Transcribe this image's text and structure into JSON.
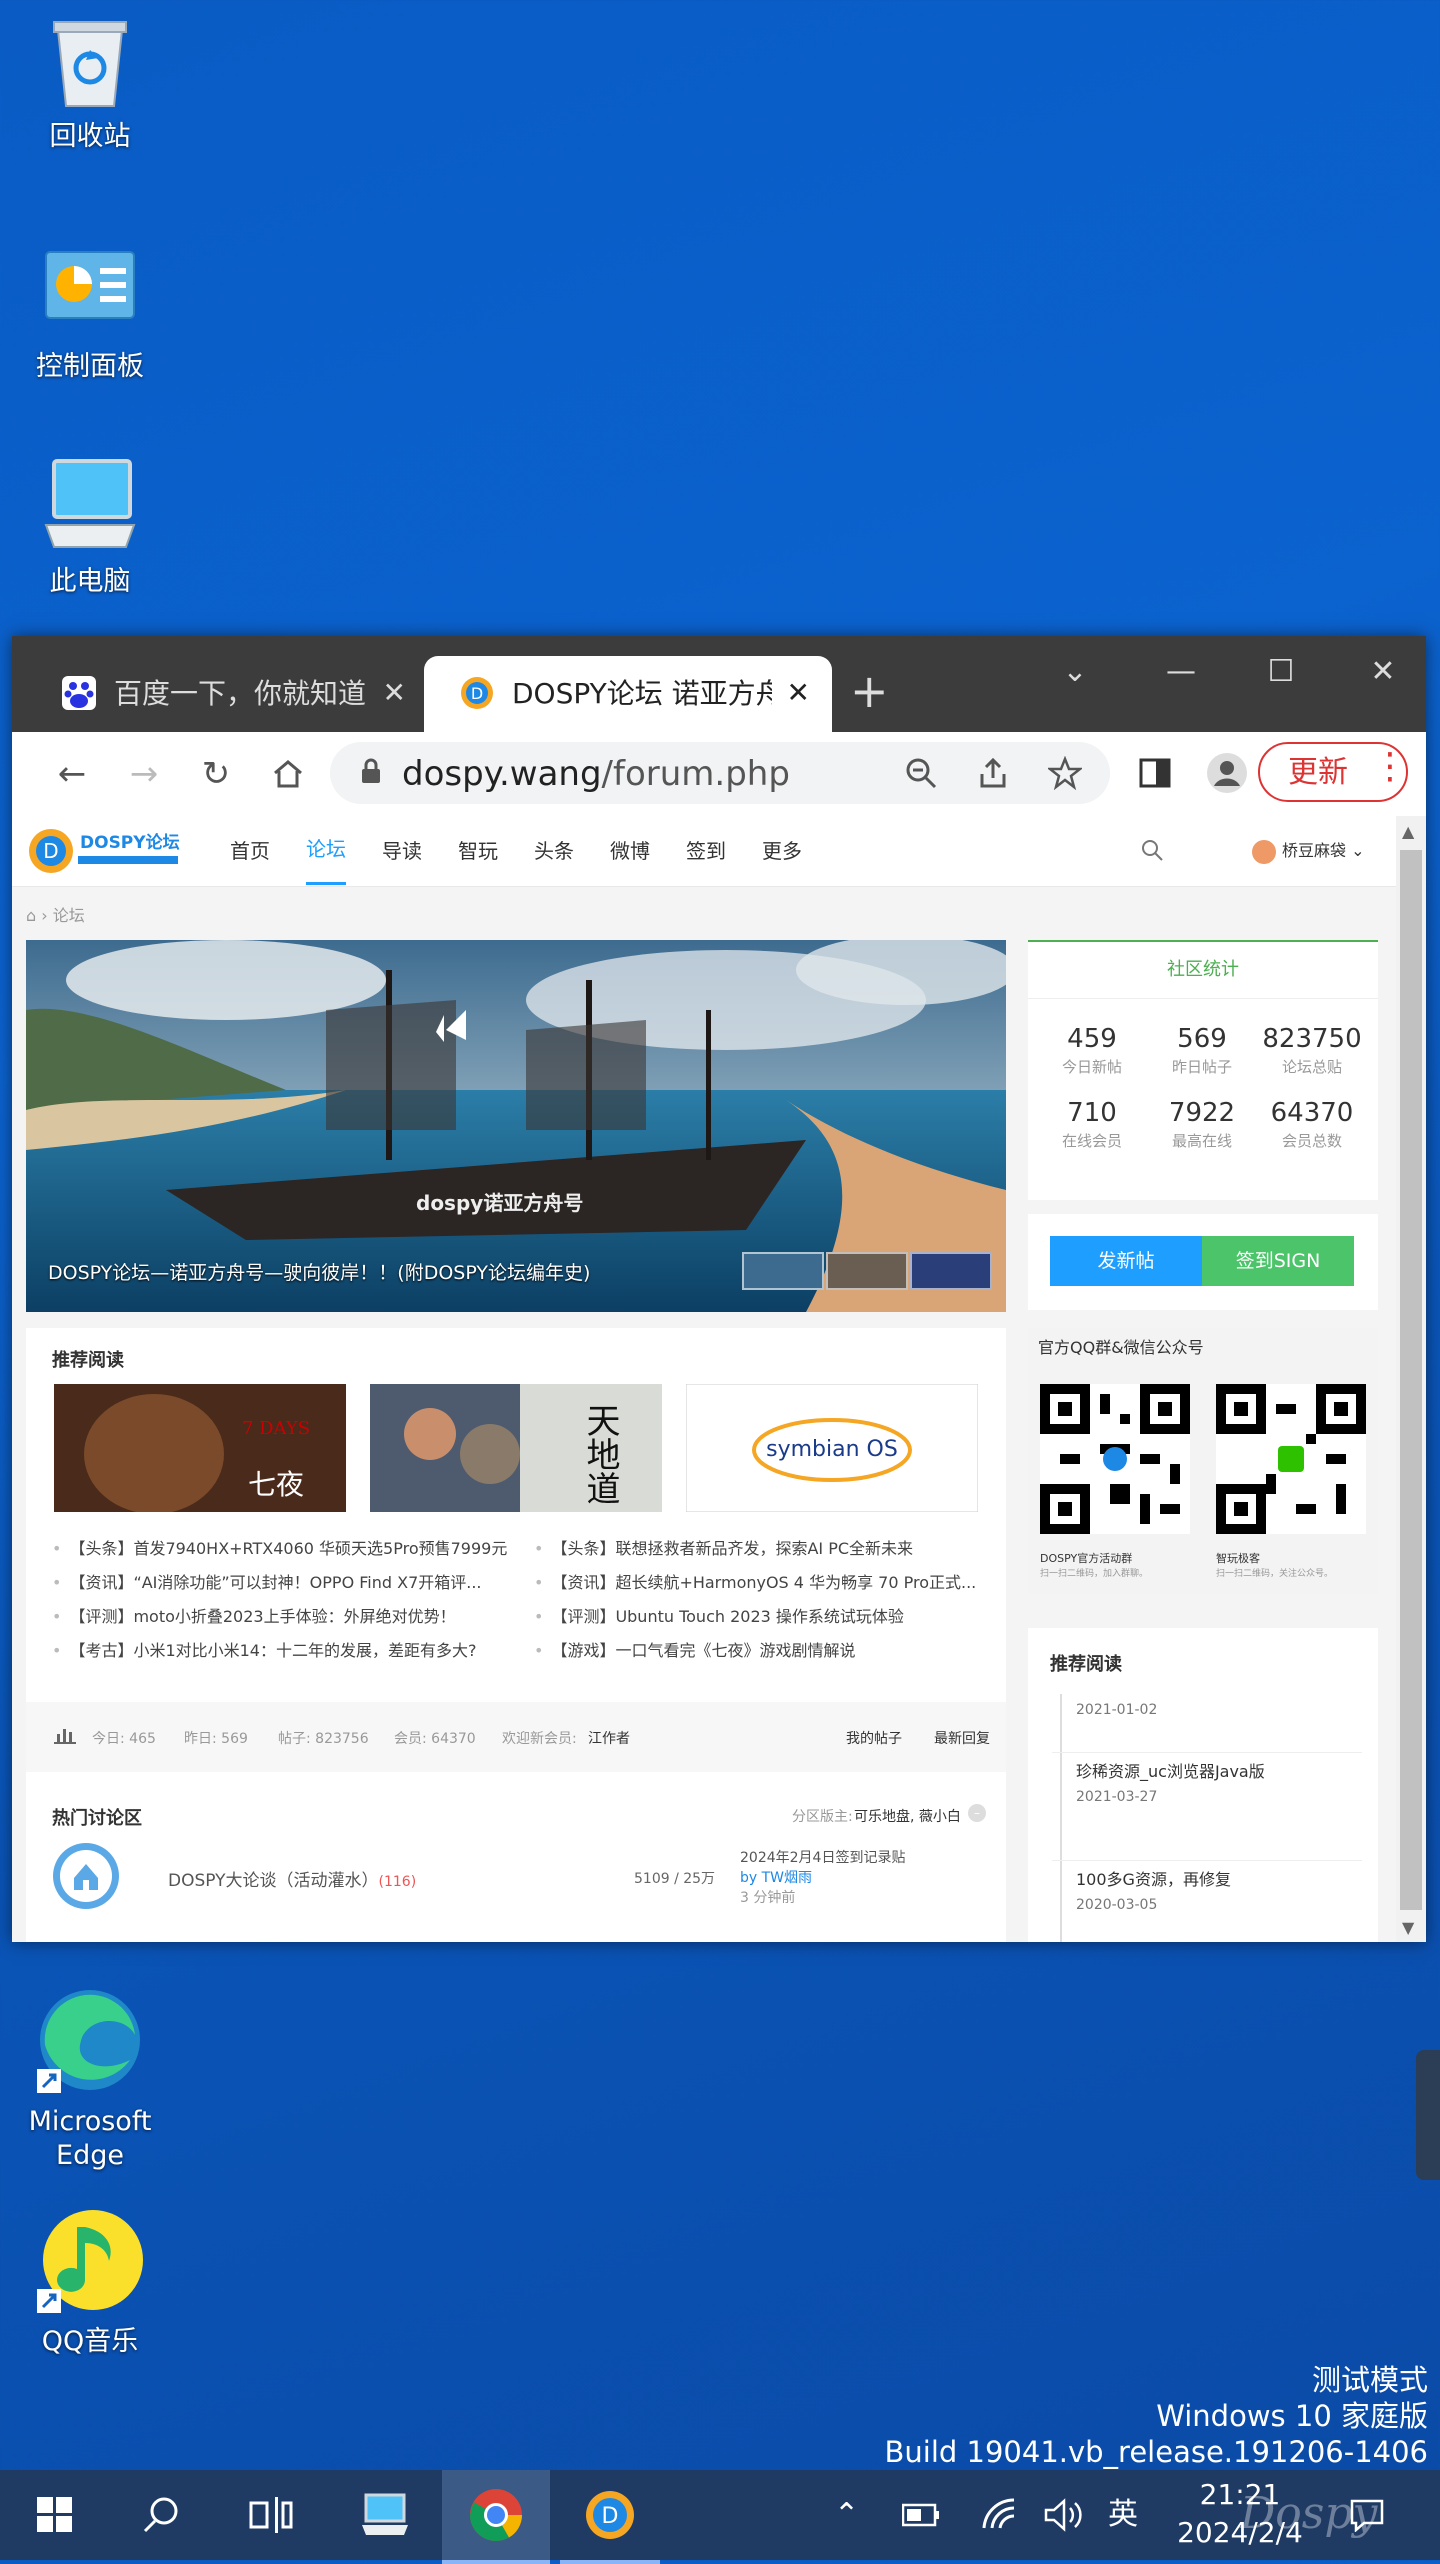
{
  "desktop": {
    "icons": [
      {
        "label": "回收站"
      },
      {
        "label": "控制面板"
      },
      {
        "label": "此电脑"
      },
      {
        "label": "Microsoft Edge"
      },
      {
        "label": "QQ音乐"
      }
    ],
    "watermark": [
      "测试模式",
      "Windows 10 家庭版",
      "Build 19041.vb_release.191206-1406"
    ]
  },
  "browser": {
    "tabs": [
      {
        "title": "百度一下，你就知道",
        "close": "✕"
      },
      {
        "title": "DOSPY论坛 诺亚方舟",
        "close": "✕"
      }
    ],
    "new_tab": "+",
    "window_controls": {
      "dropdown": "⌄",
      "minimize": "—",
      "maximize": "☐",
      "close": "✕"
    },
    "url_host": "dospy.wang",
    "url_path": "/forum.php",
    "update_label": "更新",
    "accent": "#d33333"
  },
  "site": {
    "logo_text": "DOSPY论坛",
    "nav": [
      "首页",
      "论坛",
      "导读",
      "智玩",
      "头条",
      "微博",
      "签到",
      "更多"
    ],
    "active_nav": "论坛",
    "user_name": "桥豆麻袋",
    "breadcrumb": "论坛",
    "banner_caption": "DOSPY论坛—诺亚方舟号—驶向彼岸！！(附DOSPY论坛编年史)",
    "banner_ship_text": "dospy诺亚方舟号",
    "stats": {
      "title": "社区统计",
      "items": [
        {
          "n": "459",
          "l": "今日新帖"
        },
        {
          "n": "569",
          "l": "昨日帖子"
        },
        {
          "n": "823750",
          "l": "论坛总贴"
        },
        {
          "n": "710",
          "l": "在线会员"
        },
        {
          "n": "7922",
          "l": "最高在线"
        },
        {
          "n": "64370",
          "l": "会员总数"
        }
      ]
    },
    "btn_post": "发新帖",
    "btn_sign": "签到SIGN",
    "recommend_title": "推荐阅读",
    "thumb_texts": {
      "game": "7 DAYS",
      "game_cn": "七夜",
      "tiandi": "天地道",
      "symbian": "symbian OS"
    },
    "news_left": [
      "【头条】首发7940HX+RTX4060 华硕天选5Pro预售7999元",
      "【资讯】“AI消除功能”可以封神！OPPO Find X7开箱评...",
      "【评测】moto小折叠2023上手体验：外屏绝对优势！",
      "【考古】小米1对比小米14：十二年的发展，差距有多大?"
    ],
    "news_right": [
      "【头条】联想拯救者新品齐发，探索AI PC全新未来",
      "【资讯】超长续航+HarmonyOS 4 华为畅享 70 Pro正式...",
      "【评测】Ubuntu Touch 2023 操作系统试玩体验",
      "【游戏】一口气看完《七夜》游戏剧情解说"
    ],
    "forum_stats": {
      "today": "今日: 465",
      "yesterday": "昨日: 569",
      "posts": "帖子: 823756",
      "members": "会员: 64370",
      "welcome": "欢迎新会员:",
      "new_member": "江作者",
      "my_posts": "我的帖子",
      "latest": "最新回复"
    },
    "hot": {
      "title": "热门讨论区",
      "moderators_label": "分区版主:",
      "moderators": "可乐地盘, 薇小白",
      "board_name": "DOSPY大论谈（活动灌水）",
      "board_count": "(116)",
      "board_stats": "5109 / 25万",
      "last_title": "2024年2月4日签到记录贴",
      "last_by": "by",
      "last_user": "TW烟雨",
      "last_time": "3 分钟前"
    },
    "qq_title": "官方QQ群&微信公众号",
    "qr_labels": [
      {
        "name": "DOSPY官方活动群",
        "sub": "扫一扫二维码，加入群聊。"
      },
      {
        "name": "智玩极客",
        "sub": "扫一扫二维码，关注公众号。"
      }
    ],
    "side_recommend_title": "推荐阅读",
    "timeline": [
      {
        "title": "",
        "date": "2021-01-02"
      },
      {
        "title": "珍稀资源_uc浏览器Java版",
        "date": "2021-03-27"
      },
      {
        "title": "100多G资源，再修复",
        "date": "2020-03-05"
      }
    ]
  },
  "taskbar": {
    "ime": "英",
    "time": "21:21",
    "date": "2024/2/4",
    "brand": "Dospy"
  }
}
